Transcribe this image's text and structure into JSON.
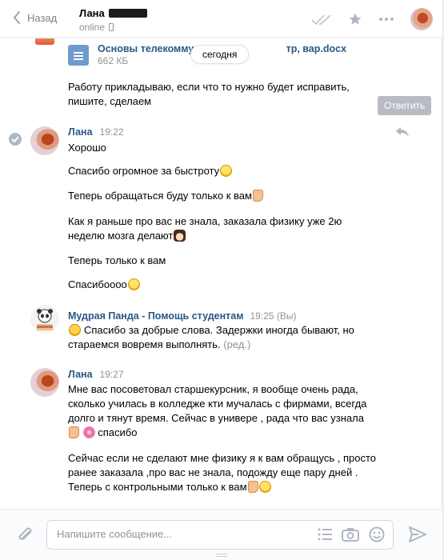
{
  "header": {
    "back_label": "Назад",
    "peer_name": "Лана",
    "peer_status": "online"
  },
  "attachment": {
    "file_name": "Основы телекоммуни",
    "file_name_tail": "тр, вар.docx",
    "file_size": "662 КБ"
  },
  "date_divider": "сегодня",
  "reply_tooltip": "Ответить",
  "messages": [
    {
      "lines": [
        "Работу прикладываю, если что то нужно будет исправить,",
        "пишите, сделаем"
      ]
    },
    {
      "author": "Лана",
      "time": "19:22",
      "paragraphs": [
        "Хорошо",
        "Спасибо огромное за быстроту",
        "Теперь обращаться буду только к вам",
        "Как я раньше про вас не знала, заказала физику уже 2ю",
        "неделю мозга делают",
        "Теперь только к вам",
        "Спасибоооо"
      ]
    },
    {
      "author": "Мудрая Панда - Помощь студентам",
      "time": "19:25 (Вы)",
      "line1": "Спасибо за добрые слова. Задержки иногда бывают, но",
      "line2": "стараемся вовремя выполнять.",
      "edited": "(ред.)"
    },
    {
      "author": "Лана",
      "time": "19:27",
      "lines": [
        "Мне вас посоветовал старшекурсник, я вообще очень рада,",
        "сколько училась в колледже кти мучалась с фирмами, всегда",
        "долго и тянут время. Сейчас в универе , рада что вас узнала",
        "спасибо",
        "Сейчас если не сделают мне физику я к вам обращусь , просто",
        "ранее заказала ,про вас не знала, подожду еще пару дней .",
        "Теперь с контрольными только к вам"
      ]
    }
  ],
  "composer": {
    "placeholder": "Напишите сообщение..."
  }
}
